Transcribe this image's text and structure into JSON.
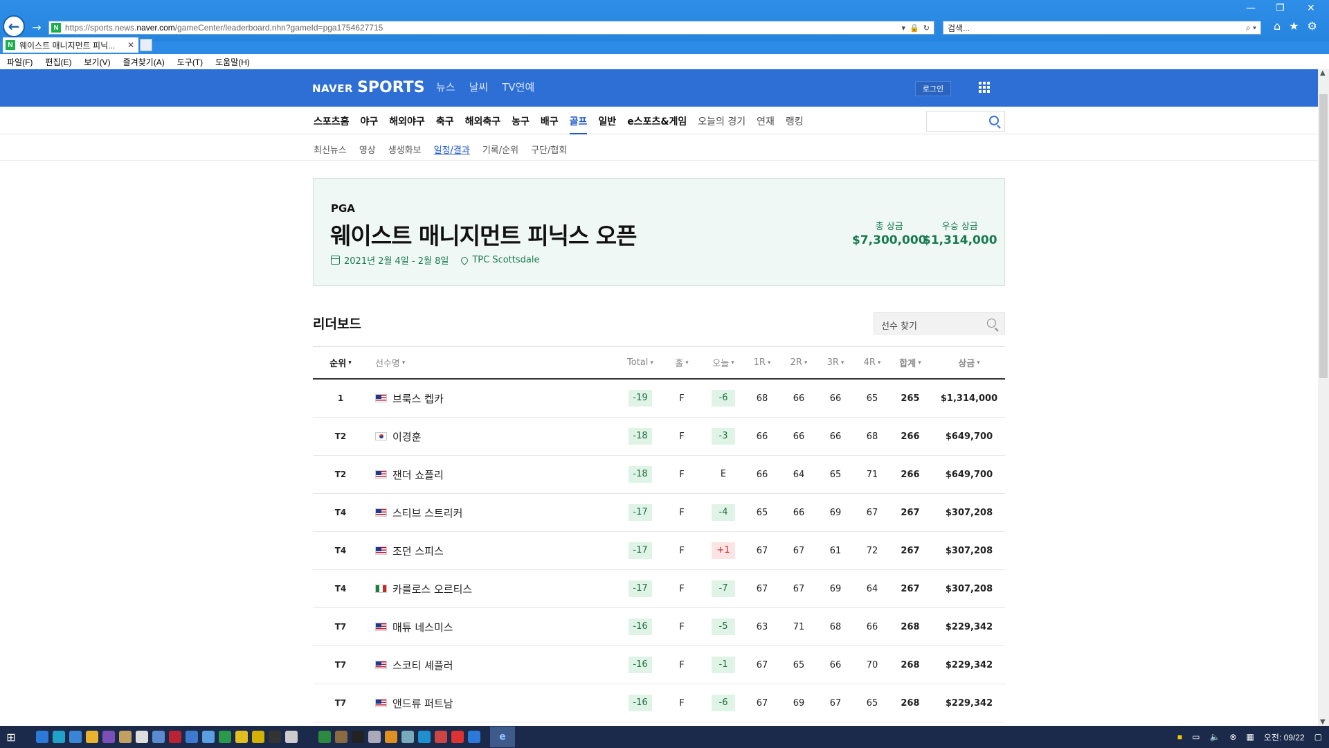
{
  "browser": {
    "url_prefix": "https://sports.news.",
    "url_host": "naver.com",
    "url_path": "/gameCenter/leaderboard.nhn?gameId=pga1754627715",
    "search_placeholder": "검색...",
    "tab_title": "웨이스트 매니지먼트 피닉...",
    "menu": [
      "파일(F)",
      "편집(E)",
      "보기(V)",
      "즐겨찾기(A)",
      "도구(T)",
      "도움말(H)"
    ]
  },
  "header": {
    "logo_naver": "NAVER",
    "logo_sports": "SPORTS",
    "topnav": [
      "뉴스",
      "날씨",
      "TV연예"
    ],
    "login": "로그인"
  },
  "gnb": {
    "items": [
      "스포츠홈",
      "야구",
      "해외야구",
      "축구",
      "해외축구",
      "농구",
      "배구",
      "골프",
      "일반",
      "e스포츠&게임",
      "오늘의 경기",
      "연재",
      "랭킹"
    ],
    "active": "골프"
  },
  "subnav": {
    "items": [
      "최신뉴스",
      "영상",
      "생생화보",
      "일정/결과",
      "기록/순위",
      "구단/협회"
    ],
    "active": "일정/결과"
  },
  "tournament": {
    "tour": "PGA",
    "title": "웨이스트 매니지먼트 피닉스 오픈",
    "dates": "2021년 2월 4일 - 2월 8일",
    "venue": "TPC Scottsdale",
    "total_purse_label": "총 상금",
    "total_purse": "$7,300,000",
    "winner_purse_label": "우승 상금",
    "winner_purse": "$1,314,000"
  },
  "leaderboard": {
    "title": "리더보드",
    "search_placeholder": "선수 찾기",
    "columns": {
      "rank": "순위",
      "player": "선수명",
      "total": "Total",
      "hole": "홀",
      "today": "오늘",
      "r1": "1R",
      "r2": "2R",
      "r3": "3R",
      "r4": "4R",
      "sum": "합계",
      "prize": "상금"
    },
    "rows": [
      {
        "rank": "1",
        "flag": "usa",
        "name": "브룩스 켑카",
        "total": "-19",
        "hole": "F",
        "today": "-6",
        "today_style": "green",
        "r1": "68",
        "r2": "66",
        "r3": "66",
        "r4": "65",
        "sum": "265",
        "prize": "$1,314,000"
      },
      {
        "rank": "T2",
        "flag": "kor",
        "name": "이경훈",
        "total": "-18",
        "hole": "F",
        "today": "-3",
        "today_style": "green",
        "r1": "66",
        "r2": "66",
        "r3": "66",
        "r4": "68",
        "sum": "266",
        "prize": "$649,700"
      },
      {
        "rank": "T2",
        "flag": "usa",
        "name": "잰더 쇼플리",
        "total": "-18",
        "hole": "F",
        "today": "E",
        "today_style": "plain",
        "r1": "66",
        "r2": "64",
        "r3": "65",
        "r4": "71",
        "sum": "266",
        "prize": "$649,700"
      },
      {
        "rank": "T4",
        "flag": "usa",
        "name": "스티브 스트리커",
        "total": "-17",
        "hole": "F",
        "today": "-4",
        "today_style": "green",
        "r1": "65",
        "r2": "66",
        "r3": "69",
        "r4": "67",
        "sum": "267",
        "prize": "$307,208"
      },
      {
        "rank": "T4",
        "flag": "usa",
        "name": "조던 스피스",
        "total": "-17",
        "hole": "F",
        "today": "+1",
        "today_style": "red",
        "r1": "67",
        "r2": "67",
        "r3": "61",
        "r4": "72",
        "sum": "267",
        "prize": "$307,208"
      },
      {
        "rank": "T4",
        "flag": "mex",
        "name": "카를로스 오르티스",
        "total": "-17",
        "hole": "F",
        "today": "-7",
        "today_style": "green",
        "r1": "67",
        "r2": "67",
        "r3": "69",
        "r4": "64",
        "sum": "267",
        "prize": "$307,208"
      },
      {
        "rank": "T7",
        "flag": "usa",
        "name": "매튜 네스미스",
        "total": "-16",
        "hole": "F",
        "today": "-5",
        "today_style": "green",
        "r1": "63",
        "r2": "71",
        "r3": "68",
        "r4": "66",
        "sum": "268",
        "prize": "$229,342"
      },
      {
        "rank": "T7",
        "flag": "usa",
        "name": "스코티 셰플러",
        "total": "-16",
        "hole": "F",
        "today": "-1",
        "today_style": "green",
        "r1": "67",
        "r2": "65",
        "r3": "66",
        "r4": "70",
        "sum": "268",
        "prize": "$229,342"
      },
      {
        "rank": "T7",
        "flag": "usa",
        "name": "앤드류 퍼트남",
        "total": "-16",
        "hole": "F",
        "today": "-6",
        "today_style": "green",
        "r1": "67",
        "r2": "69",
        "r3": "67",
        "r4": "65",
        "sum": "268",
        "prize": "$229,342"
      }
    ]
  },
  "taskbar": {
    "clock": "오전: 09/22"
  },
  "colors": {
    "naver_blue": "#2e6fd6",
    "accent_green": "#197a52",
    "active_link": "#1a56c8"
  }
}
